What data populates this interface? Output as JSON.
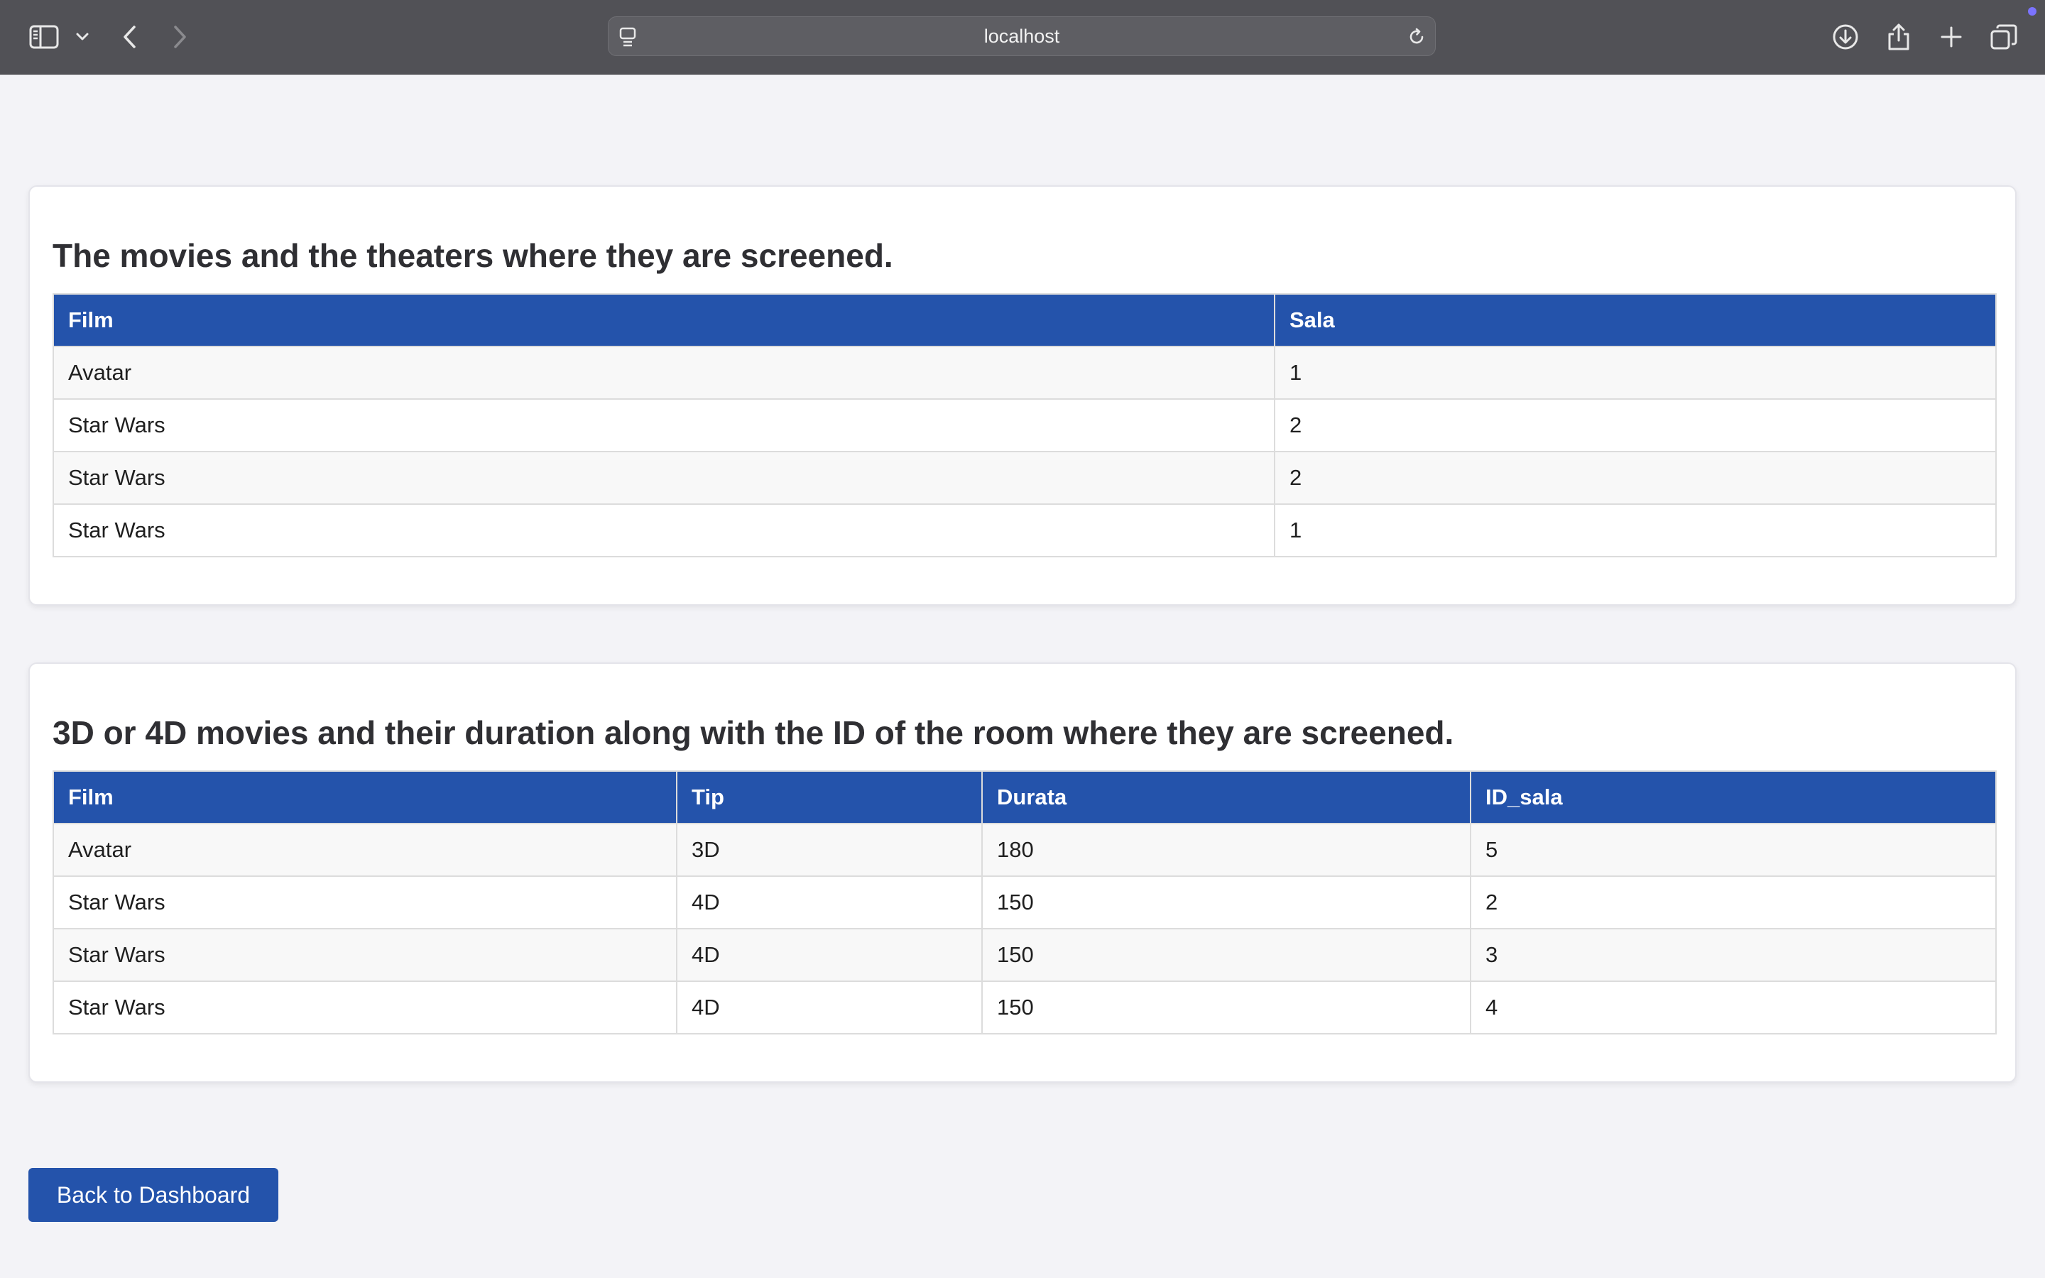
{
  "browser": {
    "url": "localhost",
    "icons": {
      "sidebar": "sidebar-icon",
      "tab_menu": "chevron-down-icon",
      "back": "chevron-left-icon",
      "forward": "chevron-right-icon",
      "site": "site-settings-icon",
      "reload": "reload-icon",
      "downloads": "download-icon",
      "share": "share-icon",
      "new_tab": "plus-icon",
      "tabs_overview": "tabs-overview-icon"
    },
    "accent": "#7b73ff"
  },
  "colors": {
    "header_blue": "#2453ab",
    "page_bg": "#f3f3f7",
    "toolbar_bg": "#515156"
  },
  "section_theaters": {
    "title": "The movies and the theaters where they are screened.",
    "columns": [
      "Film",
      "Sala"
    ],
    "rows": [
      [
        "Avatar",
        "1"
      ],
      [
        "Star Wars",
        "2"
      ],
      [
        "Star Wars",
        "2"
      ],
      [
        "Star Wars",
        "1"
      ]
    ]
  },
  "section_3d4d": {
    "title": "3D or 4D movies and their duration along with the ID of the room where they are screened.",
    "columns": [
      "Film",
      "Tip",
      "Durata",
      "ID_sala"
    ],
    "rows": [
      [
        "Avatar",
        "3D",
        "180",
        "5"
      ],
      [
        "Star Wars",
        "4D",
        "150",
        "2"
      ],
      [
        "Star Wars",
        "4D",
        "150",
        "3"
      ],
      [
        "Star Wars",
        "4D",
        "150",
        "4"
      ]
    ]
  },
  "back_button": {
    "label": "Back to Dashboard"
  }
}
